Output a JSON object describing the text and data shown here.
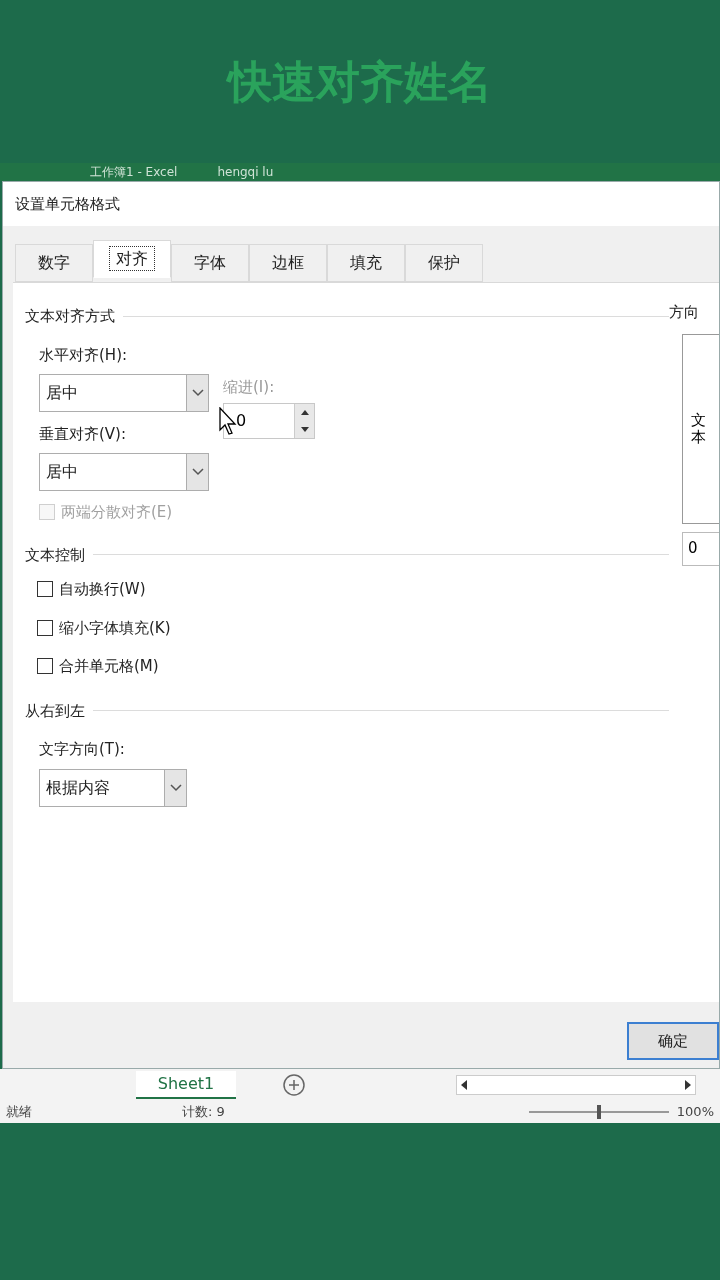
{
  "caption": "快速对齐姓名",
  "excel_titlebar": {
    "title": "工作簿1  -  Excel",
    "user": "hengqi lu"
  },
  "dialog": {
    "title": "设置单元格格式",
    "tabs": [
      {
        "label": "数字",
        "selected": false
      },
      {
        "label": "对齐",
        "selected": true
      },
      {
        "label": "字体",
        "selected": false
      },
      {
        "label": "边框",
        "selected": false
      },
      {
        "label": "填充",
        "selected": false
      },
      {
        "label": "保护",
        "selected": false
      }
    ],
    "text_alignment": {
      "heading": "文本对齐方式",
      "horizontal_label": "水平对齐(H):",
      "horizontal_value": "居中",
      "indent_label": "缩进(I):",
      "indent_value": "0",
      "vertical_label": "垂直对齐(V):",
      "vertical_value": "居中",
      "distributed": {
        "label": "两端分散对齐(E)",
        "checked": false,
        "disabled": true
      }
    },
    "text_control": {
      "heading": "文本控制",
      "options": [
        {
          "label": "自动换行(W)",
          "checked": false
        },
        {
          "label": "缩小字体填充(K)",
          "checked": false
        },
        {
          "label": "合并单元格(M)",
          "checked": false
        }
      ]
    },
    "rtl": {
      "heading": "从右到左",
      "direction_label": "文字方向(T):",
      "direction_value": "根据内容"
    },
    "orientation": {
      "heading": "方向",
      "vertical_text": "文本",
      "degrees": "0"
    },
    "ok_button": "确定"
  },
  "sheet_tabs": [
    {
      "label": "Sheet1",
      "selected": true
    }
  ],
  "status_bar": {
    "ready": "就绪",
    "count": "计数: 9",
    "zoom": "100%",
    "level": 0.5
  }
}
